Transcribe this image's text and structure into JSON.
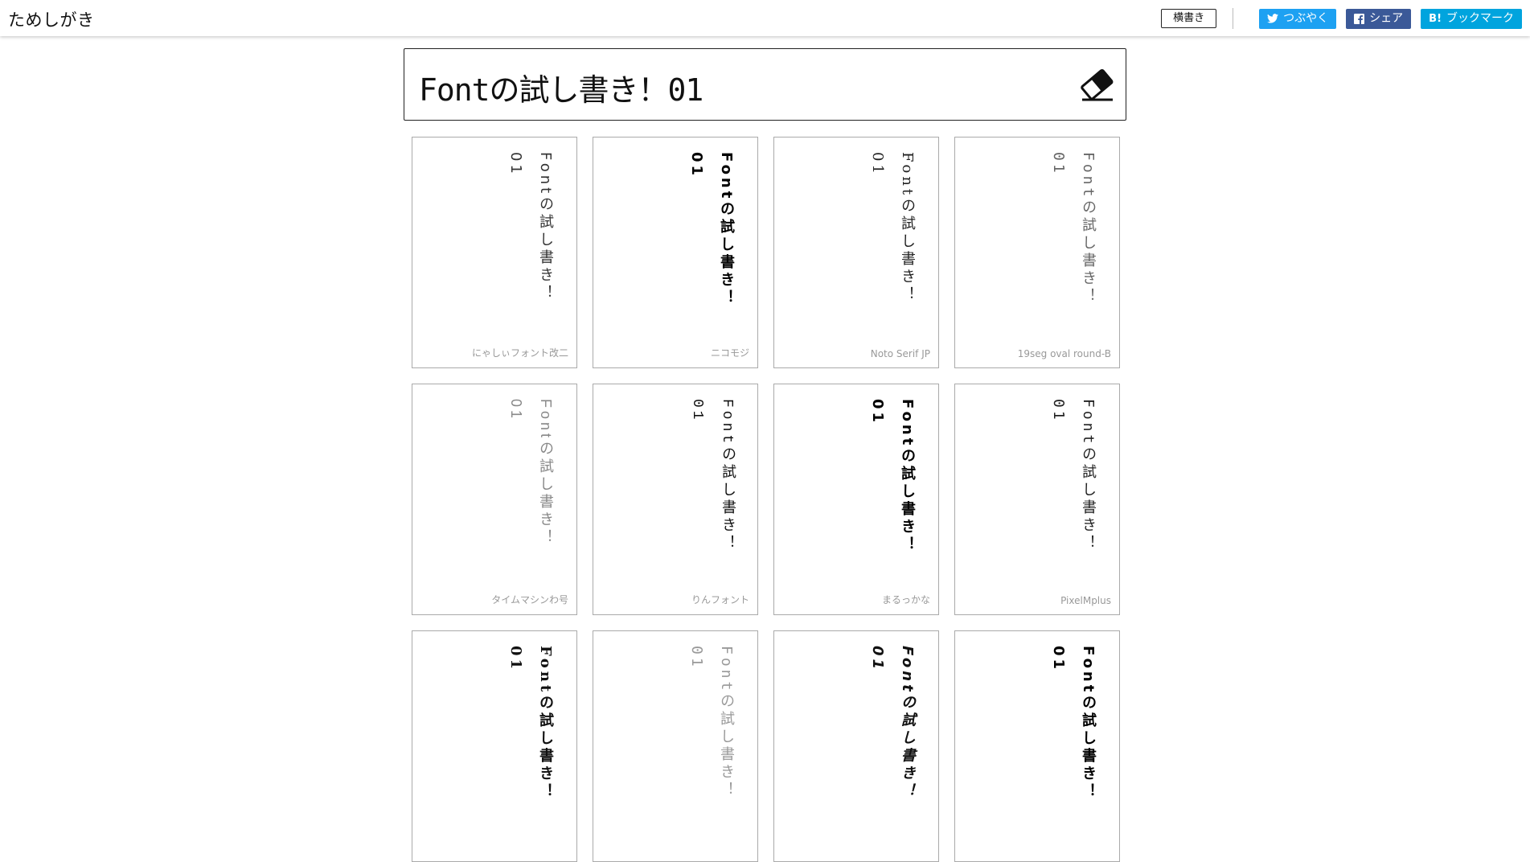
{
  "header": {
    "logo": "ためしがき",
    "mode_button": "横書き",
    "share": {
      "tweet": "つぶやく",
      "facebook": "シェア",
      "hatena": "ブックマーク",
      "hatena_mark": "B!"
    }
  },
  "input": {
    "value": "Fontの試し書き！01"
  },
  "sample_text": "Fontの試し書き！01",
  "cards": [
    {
      "font": "にゃしぃフォント改二",
      "style": "light"
    },
    {
      "font": "ニコモジ",
      "style": "bold"
    },
    {
      "font": "Noto Serif JP",
      "style": "serif"
    },
    {
      "font": "19seg oval round-B",
      "style": "segment"
    },
    {
      "font": "タイムマシンわ号",
      "style": "thin"
    },
    {
      "font": "りんフォント",
      "style": "mixed"
    },
    {
      "font": "まるっかな",
      "style": "round"
    },
    {
      "font": "PixelMplus",
      "style": "pixel"
    },
    {
      "font": "",
      "style": "slab"
    },
    {
      "font": "",
      "style": "thin-segment"
    },
    {
      "font": "",
      "style": "italic-bold"
    },
    {
      "font": "",
      "style": "heavy"
    }
  ],
  "colors": {
    "twitter": "#1da1f2",
    "facebook": "#3b5998",
    "hatena": "#00a4de",
    "label": "#999999"
  },
  "icons": {
    "eraser": "eraser-icon",
    "twitter": "twitter-icon",
    "facebook": "facebook-icon"
  }
}
